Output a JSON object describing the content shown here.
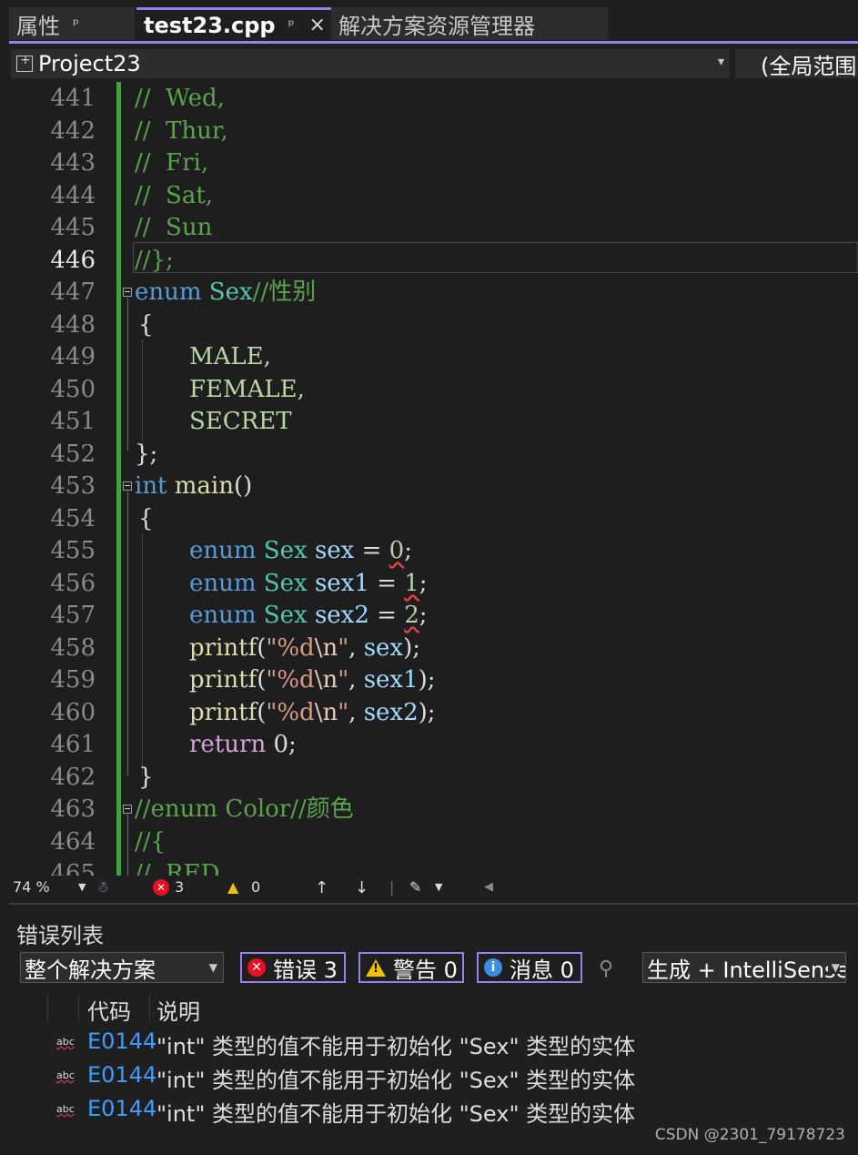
{
  "tabs": {
    "properties": "属性",
    "active_file": "test23.cpp",
    "solution_explorer": "解决方案资源管理器",
    "pin_glyph": "ᵖ",
    "close_glyph": "×"
  },
  "navbar": {
    "project": "Project23",
    "scope": "(全局范围)"
  },
  "editor": {
    "current_line": "446",
    "line_numbers": [
      "441",
      "442",
      "443",
      "444",
      "445",
      "446",
      "447",
      "448",
      "449",
      "450",
      "451",
      "452",
      "453",
      "454",
      "455",
      "456",
      "457",
      "458",
      "459",
      "460",
      "461",
      "462",
      "463",
      "464",
      "465"
    ]
  },
  "code": {
    "l441": "//  Wed,",
    "l442": "//  Thur,",
    "l443": "//  Fri,",
    "l444": "//  Sat,",
    "l445": "//  Sun",
    "l446": "//};",
    "l447_kw": "enum",
    "l447_type": "Sex",
    "l447_com": "//性别",
    "l448": "{",
    "l449": "MALE,",
    "l450": "FEMALE,",
    "l451": "SECRET",
    "l452": "};",
    "l453_kw": "int",
    "l453_fn": "main",
    "l453_rest": "()",
    "l454": "{",
    "l455_kw": "enum",
    "l455_type": "Sex",
    "l455_var": "sex",
    "l455_eq": " = ",
    "l455_num": "0",
    "l455_end": ";",
    "l456_kw": "enum",
    "l456_type": "Sex",
    "l456_var": "sex1",
    "l456_eq": " = ",
    "l456_num": "1",
    "l456_end": ";",
    "l457_kw": "enum",
    "l457_type": "Sex",
    "l457_var": "sex2",
    "l457_eq": " = ",
    "l457_num": "2",
    "l457_end": ";",
    "printf": "printf",
    "open": "(",
    "fmt_q1": "\"%d",
    "fmt_esc": "\\n",
    "fmt_q2": "\"",
    "comma": ", ",
    "l458_var": "sex",
    "l459_var": "sex1",
    "l460_var": "sex2",
    "close": ");",
    "l461_kw": "return",
    "l461_rest": " 0;",
    "l462": "}",
    "l463": "//enum Color//颜色",
    "l464": "//{",
    "l465": "//  RED,"
  },
  "editor_status": {
    "zoom": "74 %",
    "errors": "3",
    "warnings": "0",
    "up_arrow": "↑",
    "down_arrow": "↓"
  },
  "error_list": {
    "title": "错误列表",
    "scope": "整个解决方案",
    "errors_label": "错误 3",
    "warnings_label": "警告 0",
    "messages_label": "消息 0",
    "build_source": "生成 + IntelliSense",
    "col_code": "代码",
    "col_desc": "说明",
    "rows": [
      {
        "code": "E0144",
        "desc": "\"int\" 类型的值不能用于初始化 \"Sex\" 类型的实体"
      },
      {
        "code": "E0144",
        "desc": "\"int\" 类型的值不能用于初始化 \"Sex\" 类型的实体"
      },
      {
        "code": "E0144",
        "desc": "\"int\" 类型的值不能用于初始化 \"Sex\" 类型的实体"
      }
    ],
    "row_icon_text": "abc"
  },
  "watermark": "CSDN @2301_79178723"
}
